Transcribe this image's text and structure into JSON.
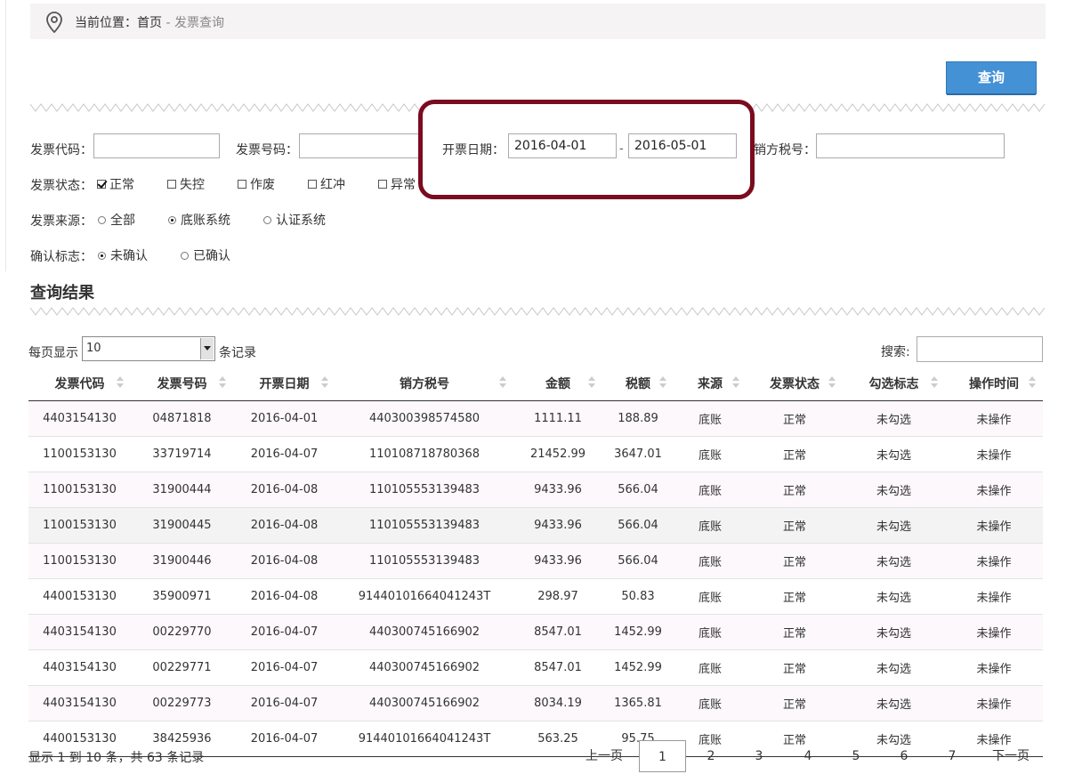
{
  "breadcrumb": {
    "prefix": "当前位置：",
    "home": "首页",
    "separator": " - ",
    "current": "发票查询"
  },
  "query_button": "查询",
  "form": {
    "invoice_code_label": "发票代码：",
    "invoice_code_value": "",
    "invoice_number_label": "发票号码：",
    "invoice_number_value": "",
    "date_label": "开票日期：",
    "date_from": "2016-04-01",
    "date_sep": "-",
    "date_to": "2016-05-01",
    "seller_tax_label": "销方税号：",
    "seller_tax_value": "",
    "status_label": "发票状态：",
    "status_options": [
      {
        "label": "正常",
        "checked": true
      },
      {
        "label": "失控",
        "checked": false
      },
      {
        "label": "作废",
        "checked": false
      },
      {
        "label": "红冲",
        "checked": false
      },
      {
        "label": "异常",
        "checked": false
      }
    ],
    "source_label": "发票来源：",
    "source_options": [
      {
        "label": "全部",
        "selected": false
      },
      {
        "label": "底账系统",
        "selected": true
      },
      {
        "label": "认证系统",
        "selected": false
      }
    ],
    "confirm_label": "确认标志：",
    "confirm_options": [
      {
        "label": "未确认",
        "selected": true
      },
      {
        "label": "已确认",
        "selected": false
      }
    ]
  },
  "results": {
    "title": "查询结果",
    "page_size_prefix": "每页显示",
    "page_size": "10",
    "page_size_suffix": "条记录",
    "search_label": "搜索:",
    "search_value": "",
    "columns": [
      "发票代码",
      "发票号码",
      "开票日期",
      "销方税号",
      "金额",
      "税额",
      "来源",
      "发票状态",
      "勾选标志",
      "操作时间"
    ],
    "rows": [
      [
        "4403154130",
        "04871818",
        "2016-04-01",
        "440300398574580",
        "1111.11",
        "188.89",
        "底账",
        "正常",
        "未勾选",
        "未操作"
      ],
      [
        "1100153130",
        "33719714",
        "2016-04-07",
        "110108718780368",
        "21452.99",
        "3647.01",
        "底账",
        "正常",
        "未勾选",
        "未操作"
      ],
      [
        "1100153130",
        "31900444",
        "2016-04-08",
        "110105553139483",
        "9433.96",
        "566.04",
        "底账",
        "正常",
        "未勾选",
        "未操作"
      ],
      [
        "1100153130",
        "31900445",
        "2016-04-08",
        "110105553139483",
        "9433.96",
        "566.04",
        "底账",
        "正常",
        "未勾选",
        "未操作"
      ],
      [
        "1100153130",
        "31900446",
        "2016-04-08",
        "110105553139483",
        "9433.96",
        "566.04",
        "底账",
        "正常",
        "未勾选",
        "未操作"
      ],
      [
        "4400153130",
        "35900971",
        "2016-04-08",
        "91440101664041243T",
        "298.97",
        "50.83",
        "底账",
        "正常",
        "未勾选",
        "未操作"
      ],
      [
        "4403154130",
        "00229770",
        "2016-04-07",
        "440300745166902",
        "8547.01",
        "1452.99",
        "底账",
        "正常",
        "未勾选",
        "未操作"
      ],
      [
        "4403154130",
        "00229771",
        "2016-04-07",
        "440300745166902",
        "8547.01",
        "1452.99",
        "底账",
        "正常",
        "未勾选",
        "未操作"
      ],
      [
        "4403154130",
        "00229773",
        "2016-04-07",
        "440300745166902",
        "8034.19",
        "1365.81",
        "底账",
        "正常",
        "未勾选",
        "未操作"
      ],
      [
        "4400153130",
        "38425936",
        "2016-04-07",
        "91440101664041243T",
        "563.25",
        "95.75",
        "底账",
        "正常",
        "未勾选",
        "未操作"
      ]
    ],
    "info": "显示 1 到 10 条，共 63 条记录",
    "pagination": {
      "prev": "上一页",
      "pages": [
        "1",
        "2",
        "3",
        "4",
        "5",
        "6",
        "7"
      ],
      "current": "1",
      "next": "下一页"
    }
  },
  "colors": {
    "highlight_border": "#7b0b1f",
    "query_button": "#4491d6",
    "breadcrumb_bg": "#f5f3f4"
  },
  "icons": {
    "breadcrumb": "map-pin-icon",
    "sort": "sort-icon",
    "select_arrow": "chevron-down-icon"
  }
}
